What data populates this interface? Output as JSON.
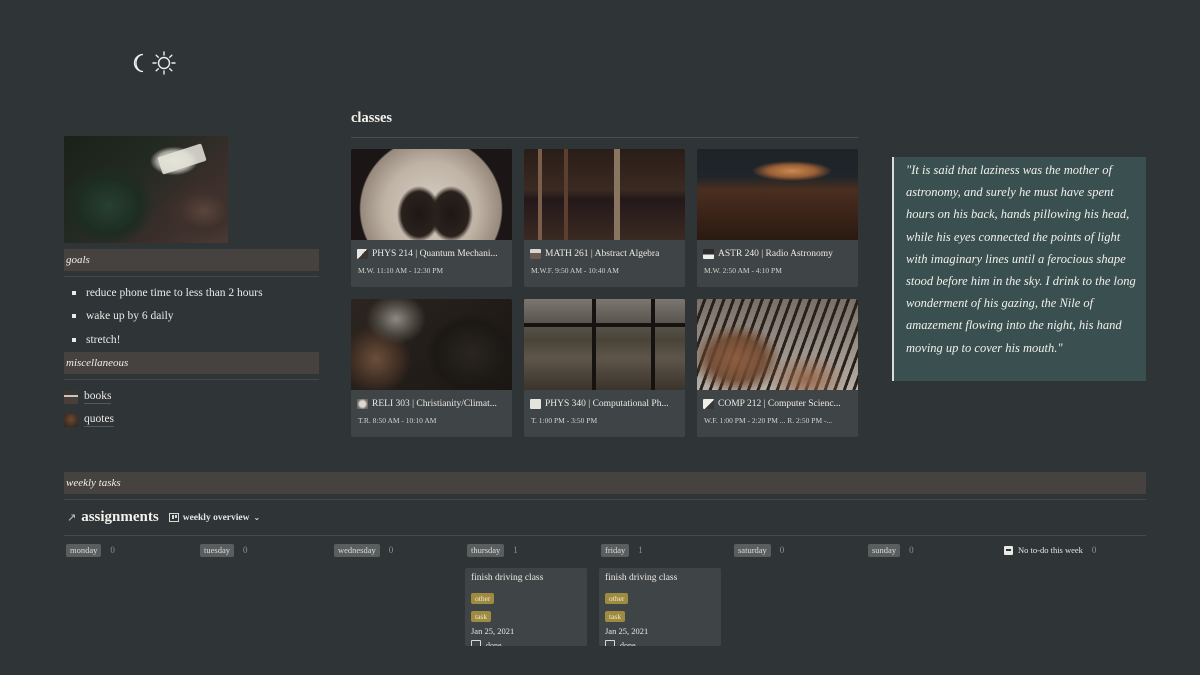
{
  "theme_icons": [
    "moon-icon",
    "sun-icon"
  ],
  "sidebar": {
    "goals_title": "goals",
    "goals": [
      "reduce phone time to less than 2 hours",
      "wake up by 6 daily",
      "stretch!"
    ],
    "misc_title": "miscellaneous",
    "misc_links": [
      {
        "label": "books",
        "icon": "books-thumbnail"
      },
      {
        "label": "quotes",
        "icon": "quotes-thumbnail"
      }
    ]
  },
  "classes": {
    "title": "classes",
    "items": [
      {
        "name": "PHYS 214 | Quantum Mechani...",
        "time": "M.W. 11:10 AM - 12:30 PM"
      },
      {
        "name": "MATH 261 | Abstract Algebra",
        "time": "M.W.F. 9:50 AM - 10:40 AM"
      },
      {
        "name": "ASTR 240 | Radio Astronomy",
        "time": "M.W. 2:50 AM - 4:10 PM"
      },
      {
        "name": "RELI 303 | Christianity/Climat...",
        "time": "T.R. 8:50 AM - 10:10 AM"
      },
      {
        "name": "PHYS 340 | Computational Ph...",
        "time": "T. 1:00 PM - 3:50 PM"
      },
      {
        "name": "COMP 212 | Computer Scienc...",
        "time": "W.F. 1:00 PM - 2:20 PM ... R. 2:50 PM -..."
      }
    ]
  },
  "quote": {
    "text": "\"It is said that laziness was the mother of astronomy, and surely he must have spent hours on his back, hands pillowing his head, while his eyes connected the points of light with imaginary lines until a ferocious shape stood before him in the sky. I drink to the long wonderment of his gazing, the Nile of amazement flowing into the night, his hand moving up to cover his mouth.\""
  },
  "weekly": {
    "title": "weekly tasks",
    "assignments_title": "assignments",
    "view_label": "weekly overview",
    "columns": [
      {
        "day": "monday",
        "count": "0"
      },
      {
        "day": "tuesday",
        "count": "0"
      },
      {
        "day": "wednesday",
        "count": "0"
      },
      {
        "day": "thursday",
        "count": "1"
      },
      {
        "day": "friday",
        "count": "1"
      },
      {
        "day": "saturday",
        "count": "0"
      },
      {
        "day": "sunday",
        "count": "0"
      }
    ],
    "no_todo": {
      "label": "No to-do this week",
      "count": "0"
    },
    "tasks": {
      "thursday": {
        "name": "finish driving class",
        "tags": [
          "other",
          "task"
        ],
        "date": "Jan 25, 2021",
        "done_label": "done"
      },
      "friday": {
        "name": "finish driving class",
        "tags": [
          "other",
          "task"
        ],
        "date": "Jan 25, 2021",
        "done_label": "done"
      }
    }
  },
  "colors": {
    "background": "#2f3437",
    "section_bar": "#464240",
    "card": "#3f4446",
    "quote_bg": "#3a4f4f",
    "tag_gold": "#9f8b3f"
  }
}
